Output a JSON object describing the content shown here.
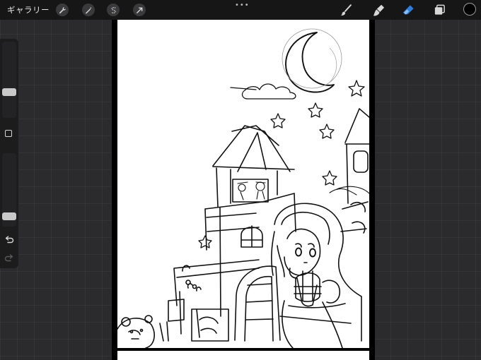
{
  "topbar": {
    "gallery_label": "ギャラリー",
    "actions_tool": "wrench-icon",
    "adjustments_tool": "magic-wand-icon",
    "selection_tool": "selection-s-icon",
    "transform_tool": "arrow-cursor-icon",
    "more_menu": "•••",
    "brush_tool": "brush-icon",
    "smudge_tool": "smudge-icon",
    "eraser_tool": "eraser-icon",
    "layers_tool": "layers-icon",
    "current_color": "#000000"
  },
  "sidebar": {
    "brush_size_level": 0.32,
    "opacity_level": 0.1,
    "undo_icon": "undo-icon",
    "redo_icon": "redo-icon"
  },
  "colors": {
    "topbar_bg": "#161617",
    "workspace_bg": "#2b2b2d",
    "eraser_active": "#2f7dd9",
    "canvas": "#ffffff"
  }
}
